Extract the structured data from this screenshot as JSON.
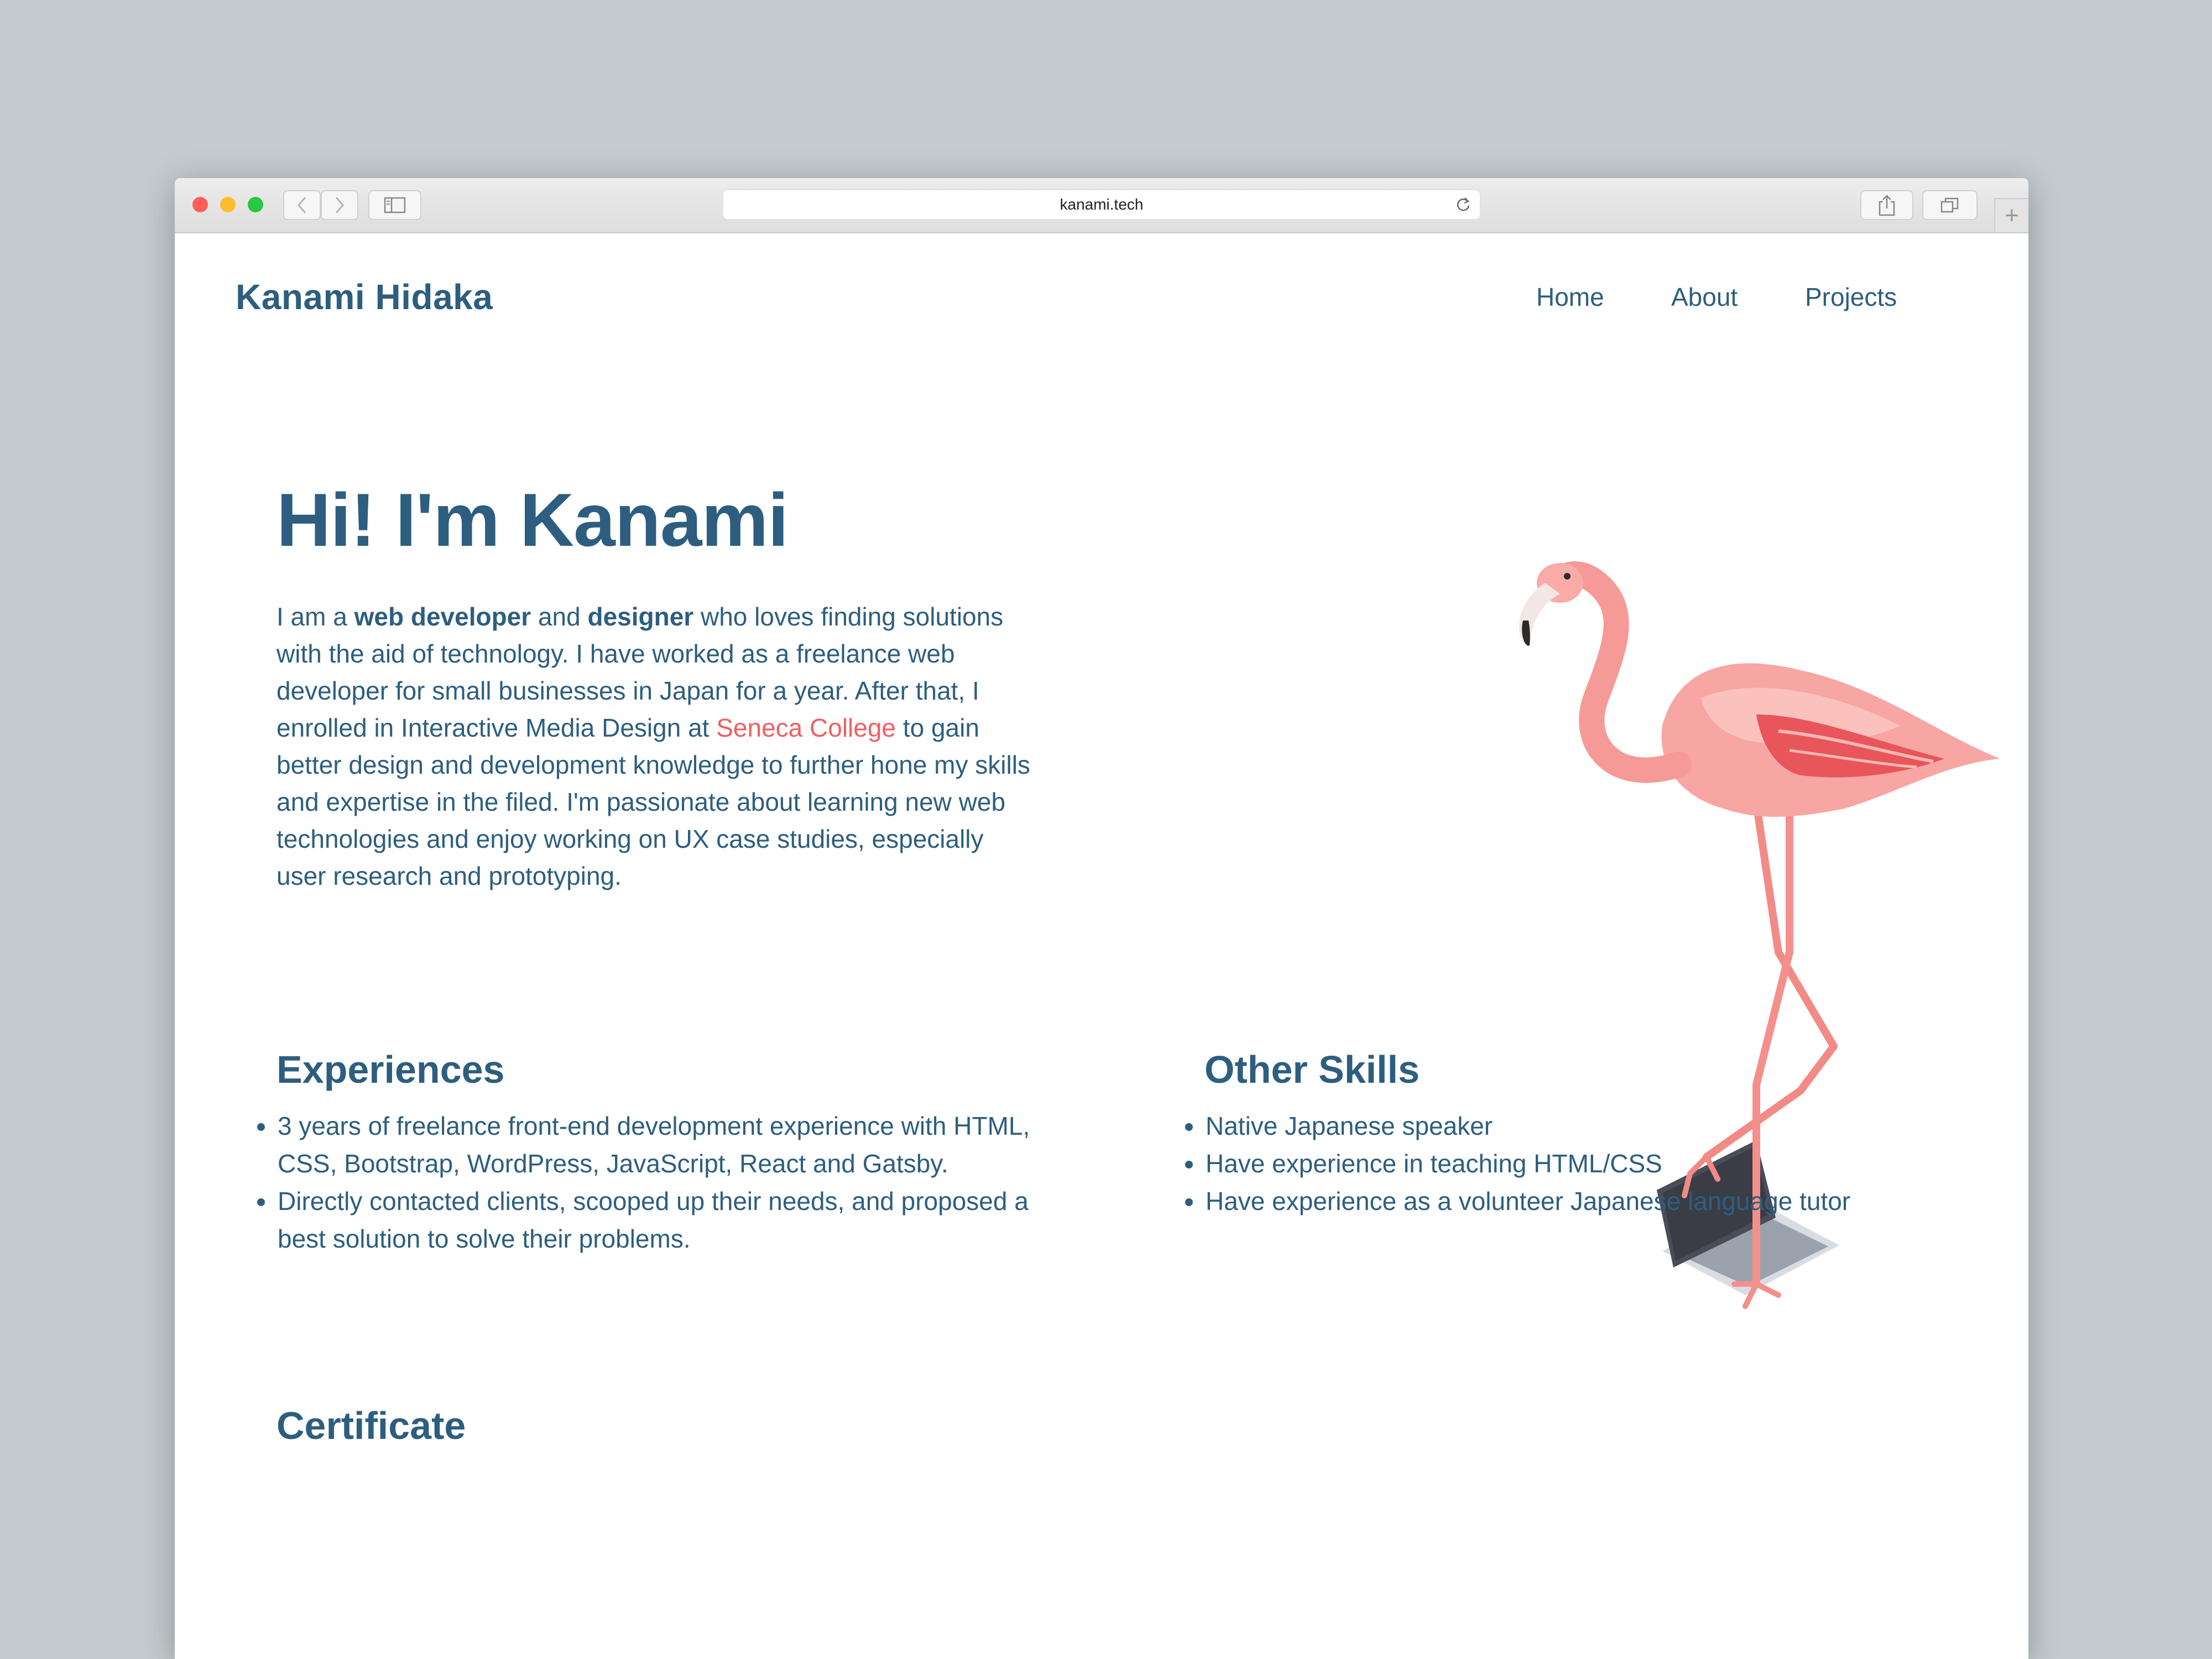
{
  "browser": {
    "url": "kanami.tech",
    "lights": {
      "close": "#fe5f57",
      "minimize": "#febc2e",
      "maximize": "#28c840"
    }
  },
  "header": {
    "brand": "Kanami Hidaka",
    "nav": [
      {
        "label": "Home"
      },
      {
        "label": "About"
      },
      {
        "label": "Projects"
      }
    ]
  },
  "hero": {
    "title": "Hi! I'm Kanami",
    "intro": {
      "p1": "I am a ",
      "b1": "web developer",
      "p2": " and ",
      "b2": "designer",
      "p3": " who loves finding solutions with the aid of technology. I have worked as a freelance web developer for small businesses in Japan for a year. After that, I enrolled in Interactive Media Design at ",
      "link": "Seneca College",
      "p4": " to gain better design and development knowledge to further hone my skills and expertise in the filed. I'm passionate about learning new web technologies and enjoy working on UX case studies, especially user research and prototyping."
    }
  },
  "experiences": {
    "title": "Experiences",
    "items": [
      "3 years of freelance front-end development experience with HTML, CSS, Bootstrap, WordPress, JavaScript, React and Gatsby.",
      "Directly contacted clients, scooped up their needs, and proposed a best solution to solve their problems."
    ]
  },
  "skills": {
    "title": "Other Skills",
    "items": [
      "Native Japanese speaker",
      "Have experience in teaching HTML/CSS",
      "Have experience as a volunteer Japanese language tutor"
    ]
  },
  "certificate": {
    "title": "Certificate"
  },
  "colors": {
    "primary": "#2d5e7f",
    "accent": "#f25e61",
    "backdrop": "#c4cbce"
  }
}
